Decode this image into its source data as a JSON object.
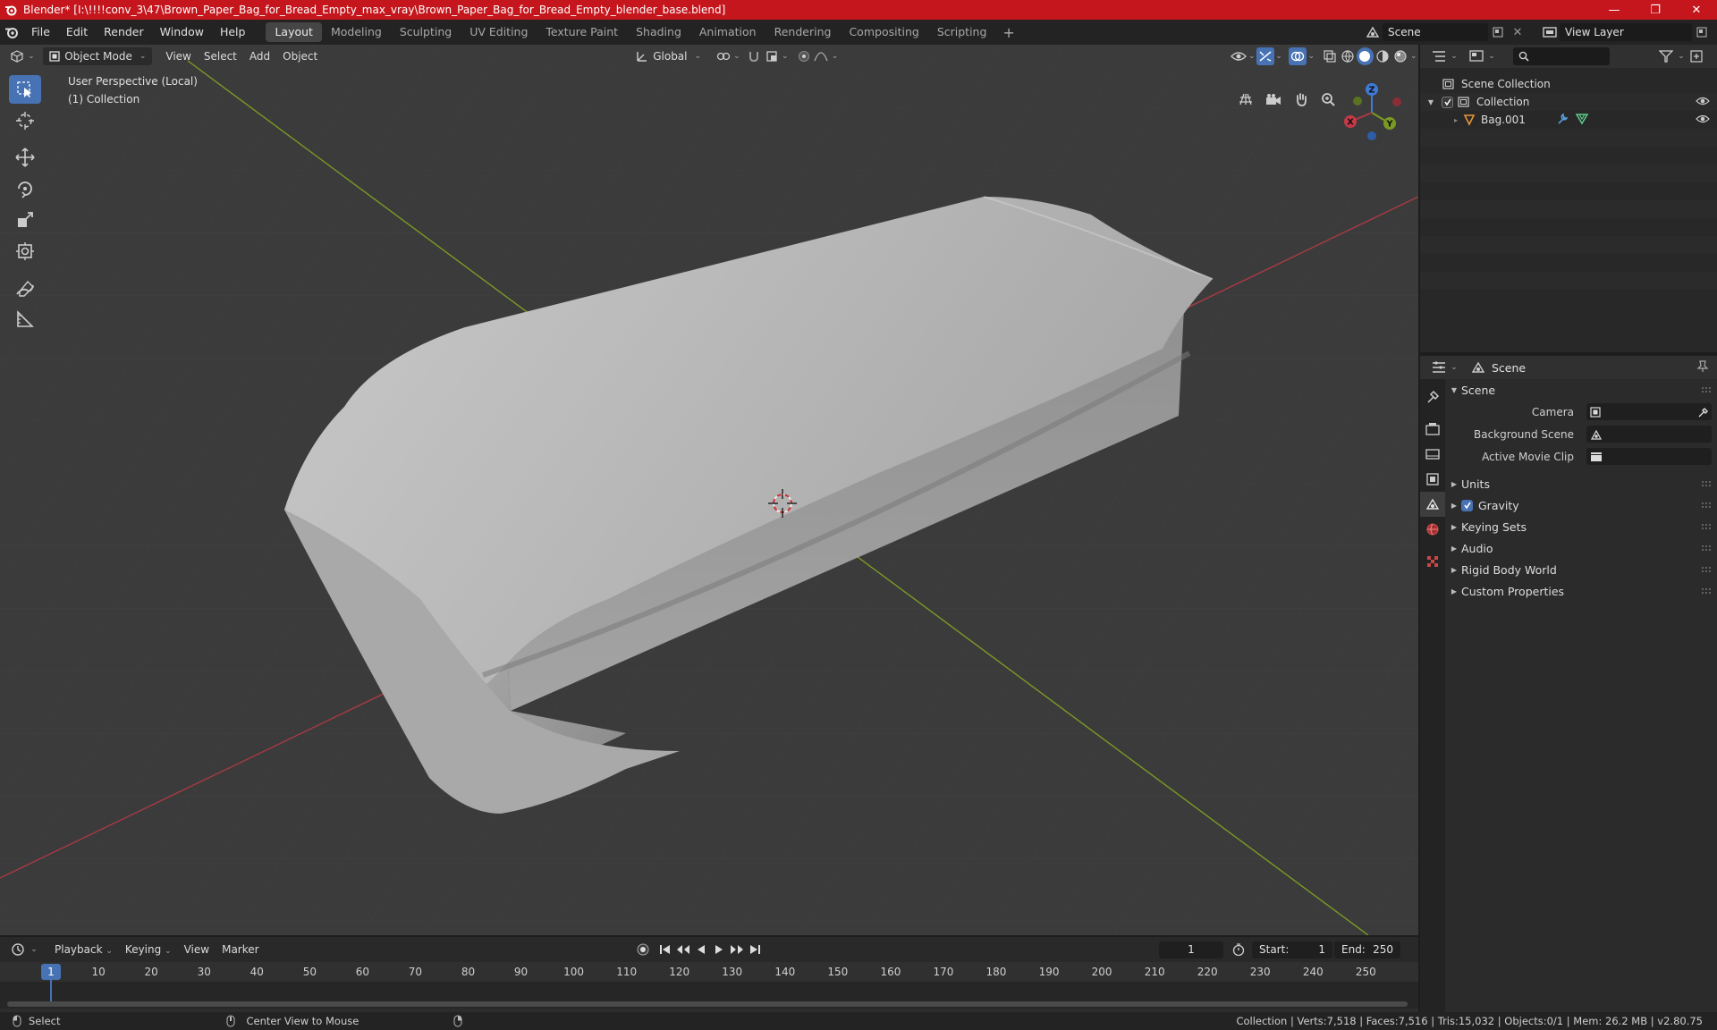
{
  "titlebar": {
    "title": "Blender* [I:\\!!!!conv_3\\47\\Brown_Paper_Bag_for_Bread_Empty_max_vray\\Brown_Paper_Bag_for_Bread_Empty_blender_base.blend]",
    "minimize": "—",
    "maximize": "❐",
    "close": "✕"
  },
  "menu": {
    "file": "File",
    "edit": "Edit",
    "render": "Render",
    "window": "Window",
    "help": "Help"
  },
  "workspaces": [
    "Layout",
    "Modeling",
    "Sculpting",
    "UV Editing",
    "Texture Paint",
    "Shading",
    "Animation",
    "Rendering",
    "Compositing",
    "Scripting"
  ],
  "active_workspace": "Layout",
  "scene_selector": {
    "value": "Scene"
  },
  "view_layer_selector": {
    "value": "View Layer"
  },
  "viewport": {
    "mode": "Object Mode",
    "view": "View",
    "select": "Select",
    "add": "Add",
    "object": "Object",
    "transform": "Global",
    "info_line1": "User Perspective (Local)",
    "info_line2": "(1) Collection",
    "gizmo": {
      "z": "Z",
      "y": "Y",
      "x": "X"
    }
  },
  "outliner": {
    "search_placeholder": "",
    "scene_collection": "Scene Collection",
    "collection": "Collection",
    "object": "Bag.001"
  },
  "properties": {
    "header": "Scene",
    "panel_title": "Scene",
    "camera_label": "Camera",
    "background_scene_label": "Background Scene",
    "active_movie_clip_label": "Active Movie Clip",
    "sections": {
      "units": "Units",
      "gravity": "Gravity",
      "keying_sets": "Keying Sets",
      "audio": "Audio",
      "rigid_body_world": "Rigid Body World",
      "custom_properties": "Custom Properties"
    }
  },
  "timeline": {
    "playback": "Playback",
    "keying": "Keying",
    "view": "View",
    "marker": "Marker",
    "current_frame": "1",
    "start_label": "Start:",
    "start_value": "1",
    "end_label": "End:",
    "end_value": "250",
    "playhead_label": "1",
    "ticks": [
      "10",
      "20",
      "30",
      "40",
      "50",
      "60",
      "70",
      "80",
      "90",
      "100",
      "110",
      "120",
      "130",
      "140",
      "150",
      "160",
      "170",
      "180",
      "190",
      "200",
      "210",
      "220",
      "230",
      "240",
      "250"
    ]
  },
  "statusbar": {
    "select": "Select",
    "center_view": "Center View to Mouse",
    "stats": "Collection | Verts:7,518 | Faces:7,516 | Tris:15,032 | Objects:0/1 | Mem: 26.2 MB | v2.80.75"
  },
  "colors": {
    "titlebar": "#c5161d",
    "accent": "#4772b3",
    "viewport_bg": "#3b3b3b",
    "x_axis": "#a83a44",
    "y_axis": "#7b9a24",
    "z_axis": "#3f7bd6"
  }
}
